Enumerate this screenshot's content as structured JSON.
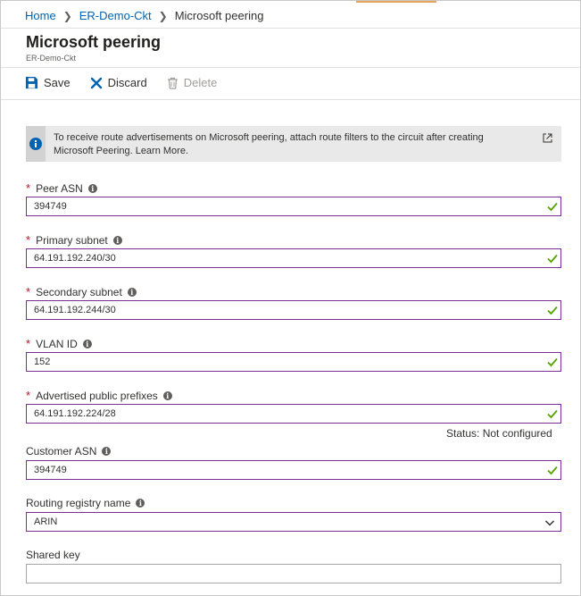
{
  "breadcrumb": {
    "home": "Home",
    "circuit": "ER-Demo-Ckt",
    "current": "Microsoft peering"
  },
  "header": {
    "title": "Microsoft peering",
    "subtitle": "ER-Demo-Ckt"
  },
  "toolbar": {
    "save": "Save",
    "discard": "Discard",
    "delete": "Delete"
  },
  "info": {
    "line1": "To receive route advertisements on Microsoft peering, attach route filters to the circuit after creating",
    "line2": "Microsoft Peering. Learn More."
  },
  "fields": {
    "peer_asn": {
      "label": "Peer ASN",
      "value": "394749"
    },
    "primary_subnet": {
      "label": "Primary subnet",
      "value": "64.191.192.240/30"
    },
    "secondary_subnet": {
      "label": "Secondary subnet",
      "value": "64.191.192.244/30"
    },
    "vlan_id": {
      "label": "VLAN ID",
      "value": "152"
    },
    "advertised_prefixes": {
      "label": "Advertised public prefixes",
      "value": "64.191.192.224/28",
      "status": "Status: Not configured"
    },
    "customer_asn": {
      "label": "Customer ASN",
      "value": "394749"
    },
    "routing_registry": {
      "label": "Routing registry name",
      "value": "ARIN"
    },
    "shared_key": {
      "label": "Shared key",
      "value": ""
    }
  },
  "required_marker": "*",
  "colors": {
    "link": "#0063b1",
    "input_border": "#7a2f92",
    "valid_check": "#57a300",
    "required": "#c50f1f",
    "accent": "#e8a35a"
  },
  "icons": {
    "save": "save-icon",
    "discard": "close-x-icon",
    "delete": "trash-icon",
    "info": "info-icon",
    "external": "external-link-icon",
    "valid": "checkmark-icon",
    "dropdown": "chevron-down-icon"
  }
}
